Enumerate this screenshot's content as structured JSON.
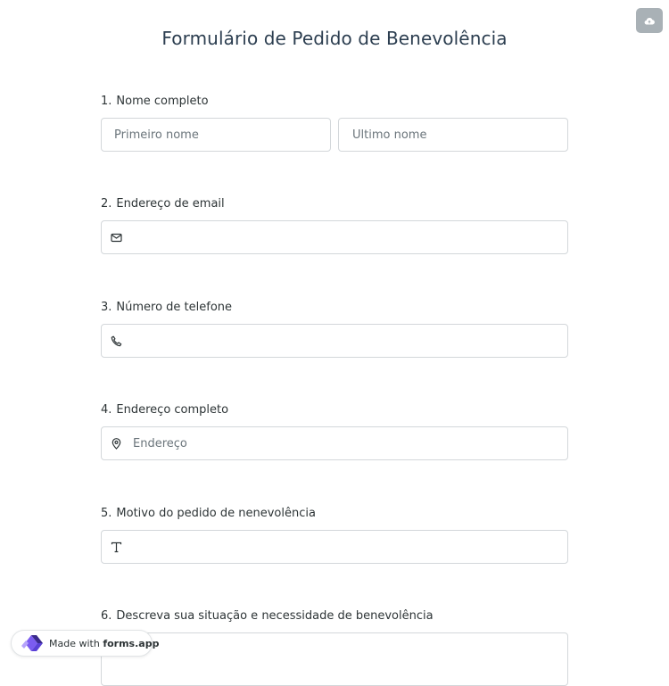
{
  "form": {
    "title": "Formulário de Pedido de Benevolência"
  },
  "toolbar": {
    "save_icon": "cloud-upload-icon"
  },
  "questions": [
    {
      "number": "1.",
      "label": "Nome completo",
      "first_name_placeholder": "Primeiro nome",
      "last_name_placeholder": "Último nome"
    },
    {
      "number": "2.",
      "label": "Endereço de email",
      "icon": "envelope-icon",
      "placeholder": ""
    },
    {
      "number": "3.",
      "label": "Número de telefone",
      "icon": "phone-icon",
      "placeholder": ""
    },
    {
      "number": "4.",
      "label": "Endereço completo",
      "icon": "map-pin-icon",
      "placeholder": "Endereço"
    },
    {
      "number": "5.",
      "label": "Motivo do pedido de nenevolência",
      "icon": "text-icon",
      "placeholder": ""
    },
    {
      "number": "6.",
      "label": "Descreva sua situação e necessidade de benevolência",
      "placeholder": ""
    }
  ],
  "badge": {
    "prefix": "Made with",
    "brand": "forms.app"
  },
  "colors": {
    "border": "#d3d7da",
    "text": "#2d3436",
    "placeholder": "#6b757b",
    "save_button": "#a9b1b6",
    "logo_purple": "#7b5cf0",
    "logo_dark": "#3a2a8c"
  }
}
